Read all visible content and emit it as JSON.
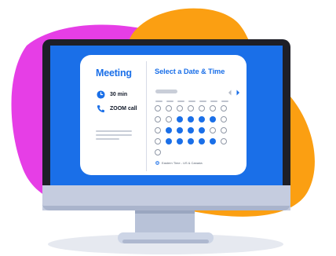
{
  "meeting": {
    "title": "Meeting",
    "duration": "30 min",
    "location": "ZOOM call"
  },
  "scheduler": {
    "title": "Select a Date & Time",
    "timezone": "Eastern Time - US & Canada",
    "grid": [
      [
        "out",
        "out",
        "out",
        "out",
        "out",
        "out",
        "out"
      ],
      [
        "out",
        "out",
        "available",
        "available",
        "available",
        "available",
        "out"
      ],
      [
        "out",
        "available",
        "available",
        "available",
        "available",
        "out",
        "out"
      ],
      [
        "out",
        "available",
        "available",
        "available",
        "available",
        "available",
        "out"
      ],
      [
        "out",
        "blank",
        "blank",
        "blank",
        "blank",
        "blank",
        "blank"
      ]
    ]
  },
  "colors": {
    "accent": "#1a6fe8",
    "screen_background": "#1a6fe8",
    "magenta_blob": "#e63ee6",
    "orange_blob": "#fb9f12",
    "bezel": "#1e1f27",
    "chin": "#c5ccdf",
    "stand": "#c8d0e2"
  },
  "icons": {
    "clock": "clock-icon",
    "phone": "phone-icon",
    "globe": "globe-icon",
    "previous": "chevron-left-icon",
    "next": "chevron-right-icon"
  }
}
